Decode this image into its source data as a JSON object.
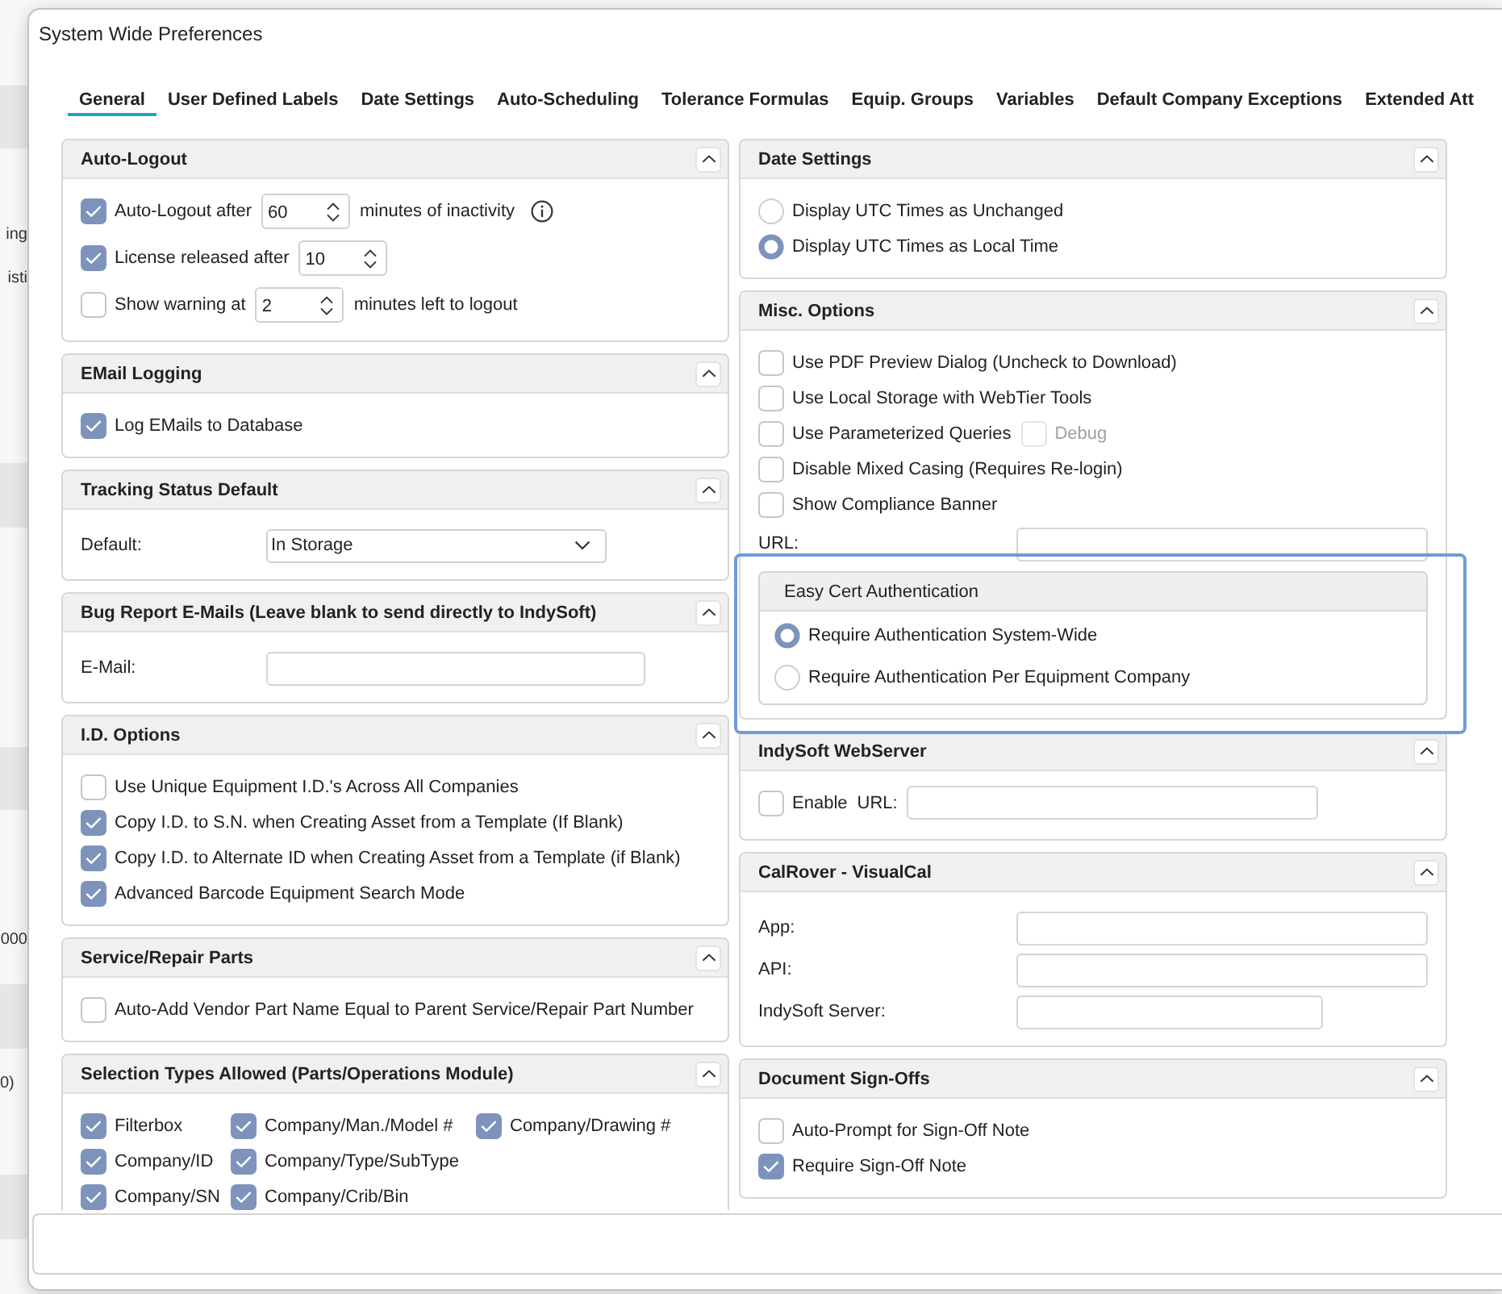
{
  "background": {
    "fragments": [
      "ing",
      "isti",
      "000",
      "0)"
    ]
  },
  "window": {
    "title": "System Wide Preferences"
  },
  "tabs": [
    {
      "label": "General",
      "selected": true
    },
    {
      "label": "User Defined Labels",
      "selected": false
    },
    {
      "label": "Date Settings",
      "selected": false
    },
    {
      "label": "Auto-Scheduling",
      "selected": false
    },
    {
      "label": "Tolerance Formulas",
      "selected": false
    },
    {
      "label": "Equip. Groups",
      "selected": false
    },
    {
      "label": "Variables",
      "selected": false
    },
    {
      "label": "Default Company Exceptions",
      "selected": false
    },
    {
      "label": "Extended Att",
      "selected": false
    }
  ],
  "columns": [
    {
      "panels": [
        {
          "title": "Auto-Logout",
          "expanded": true,
          "rows": [
            {
              "kind": "inline",
              "controls": [
                {
                  "kind": "checkbox",
                  "label": "Auto-Logout after",
                  "checked": true,
                  "disabled": false
                },
                {
                  "kind": "spinner",
                  "value": "60"
                },
                {
                  "kind": "text",
                  "text": "minutes of inactivity",
                  "info_icon": true
                }
              ]
            },
            {
              "kind": "inline",
              "controls": [
                {
                  "kind": "checkbox",
                  "label": "License released after",
                  "checked": true,
                  "disabled": false
                },
                {
                  "kind": "spinner",
                  "value": "10"
                }
              ]
            },
            {
              "kind": "inline",
              "controls": [
                {
                  "kind": "checkbox",
                  "label": "Show warning at",
                  "checked": false,
                  "disabled": false
                },
                {
                  "kind": "spinner",
                  "value": "2"
                },
                {
                  "kind": "text",
                  "text": "minutes left to logout",
                  "info_icon": false
                }
              ]
            }
          ]
        },
        {
          "title": "EMail Logging",
          "expanded": true,
          "rows": [
            {
              "kind": "inline",
              "controls": [
                {
                  "kind": "checkbox",
                  "label": "Log EMails to Database",
                  "checked": true,
                  "disabled": false
                }
              ]
            }
          ]
        },
        {
          "title": "Tracking Status Default",
          "expanded": true,
          "rows": [
            {
              "kind": "select",
              "label": "Default:",
              "value": "In Storage"
            }
          ]
        },
        {
          "title": "Bug Report E-Mails (Leave blank to send directly to IndySoft)",
          "expanded": true,
          "rows": [
            {
              "kind": "field",
              "label": "E-Mail:"
            }
          ]
        },
        {
          "title": "I.D. Options",
          "expanded": true,
          "rows": [
            {
              "kind": "inline",
              "controls": [
                {
                  "kind": "checkbox",
                  "label": "Use Unique Equipment I.D.'s Across All Companies",
                  "checked": false,
                  "disabled": false
                }
              ]
            },
            {
              "kind": "inline",
              "controls": [
                {
                  "kind": "checkbox",
                  "label": "Copy I.D. to S.N. when Creating Asset from a Template (If Blank)",
                  "checked": true,
                  "disabled": false
                }
              ]
            },
            {
              "kind": "inline",
              "controls": [
                {
                  "kind": "checkbox",
                  "label": "Copy I.D. to Alternate ID when Creating Asset from a Template (if Blank)",
                  "checked": true,
                  "disabled": false
                }
              ]
            },
            {
              "kind": "inline",
              "controls": [
                {
                  "kind": "checkbox",
                  "label": "Advanced Barcode Equipment Search Mode",
                  "checked": true,
                  "disabled": false
                }
              ]
            }
          ]
        },
        {
          "title": "Service/Repair Parts",
          "expanded": true,
          "rows": [
            {
              "kind": "inline",
              "controls": [
                {
                  "kind": "checkbox",
                  "label": "Auto-Add Vendor Part Name Equal to Parent Service/Repair Part Number",
                  "checked": false,
                  "disabled": false
                }
              ]
            }
          ]
        },
        {
          "title": "Selection Types Allowed (Parts/Operations Module)",
          "expanded": true,
          "rows": [
            {
              "kind": "grid",
              "controls": [
                {
                  "kind": "checkbox",
                  "label": "Filterbox",
                  "checked": true,
                  "disabled": false
                },
                {
                  "kind": "checkbox",
                  "label": "Company/Man./Model #",
                  "checked": true,
                  "disabled": false
                },
                {
                  "kind": "checkbox",
                  "label": "Company/Drawing #",
                  "checked": true,
                  "disabled": false
                }
              ]
            },
            {
              "kind": "grid",
              "controls": [
                {
                  "kind": "checkbox",
                  "label": "Company/ID",
                  "checked": true,
                  "disabled": false
                },
                {
                  "kind": "checkbox",
                  "label": "Company/Type/SubType",
                  "checked": true,
                  "disabled": false
                }
              ]
            },
            {
              "kind": "grid",
              "controls": [
                {
                  "kind": "checkbox",
                  "label": "Company/SN",
                  "checked": true,
                  "disabled": false
                },
                {
                  "kind": "checkbox",
                  "label": "Company/Crib/Bin",
                  "checked": true,
                  "disabled": false
                }
              ]
            }
          ]
        }
      ]
    },
    {
      "panels": [
        {
          "title": "Date Settings",
          "expanded": true,
          "rows": [
            {
              "kind": "radio",
              "label": "Display UTC Times as Unchanged",
              "selected": false
            },
            {
              "kind": "radio",
              "label": "Display UTC Times as Local Time",
              "selected": true
            }
          ]
        },
        {
          "title": "Misc. Options",
          "expanded": true,
          "rows": [
            {
              "kind": "inline",
              "controls": [
                {
                  "kind": "checkbox",
                  "label": "Use PDF Preview Dialog (Uncheck to Download)",
                  "checked": false,
                  "disabled": false
                }
              ]
            },
            {
              "kind": "inline",
              "controls": [
                {
                  "kind": "checkbox",
                  "label": "Use Local Storage with WebTier Tools",
                  "checked": false,
                  "disabled": false
                }
              ]
            },
            {
              "kind": "inline",
              "controls": [
                {
                  "kind": "checkbox",
                  "label": "Use Parameterized Queries",
                  "checked": false,
                  "disabled": false
                },
                {
                  "kind": "checkbox",
                  "label": "Debug",
                  "checked": false,
                  "disabled": true
                }
              ]
            },
            {
              "kind": "inline",
              "controls": [
                {
                  "kind": "checkbox",
                  "label": "Disable Mixed Casing (Requires Re-login)",
                  "checked": false,
                  "disabled": false
                }
              ]
            },
            {
              "kind": "inline",
              "controls": [
                {
                  "kind": "checkbox",
                  "label": "Show Compliance Banner",
                  "checked": false,
                  "disabled": false
                }
              ]
            },
            {
              "kind": "field",
              "label": "URL:"
            },
            {
              "kind": "group",
              "title": "Easy Cert Authentication",
              "focused": true,
              "rows": [
                {
                  "kind": "radio",
                  "label": "Require Authentication System-Wide",
                  "selected": true
                },
                {
                  "kind": "radio",
                  "label": "Require Authentication Per Equipment Company",
                  "selected": false
                }
              ]
            }
          ]
        },
        {
          "title": "IndySoft WebServer",
          "expanded": true,
          "rows": [
            {
              "kind": "inline",
              "controls": [
                {
                  "kind": "checkbox",
                  "label": "Enable",
                  "checked": false,
                  "disabled": false
                },
                {
                  "kind": "text",
                  "text": "URL:",
                  "info_icon": false
                },
                {
                  "kind": "input"
                }
              ]
            }
          ]
        },
        {
          "title": "CalRover - VisualCal",
          "expanded": true,
          "rows": [
            {
              "kind": "field",
              "label": "App:"
            },
            {
              "kind": "field",
              "label": "API:"
            },
            {
              "kind": "field",
              "label": "IndySoft Server:"
            }
          ]
        },
        {
          "title": "Document Sign-Offs",
          "expanded": true,
          "rows": [
            {
              "kind": "inline",
              "controls": [
                {
                  "kind": "checkbox",
                  "label": "Auto-Prompt for Sign-Off Note",
                  "checked": false,
                  "disabled": false
                }
              ]
            },
            {
              "kind": "inline",
              "controls": [
                {
                  "kind": "checkbox",
                  "label": "Require Sign-Off Note",
                  "checked": true,
                  "disabled": false
                }
              ]
            }
          ]
        }
      ]
    }
  ]
}
